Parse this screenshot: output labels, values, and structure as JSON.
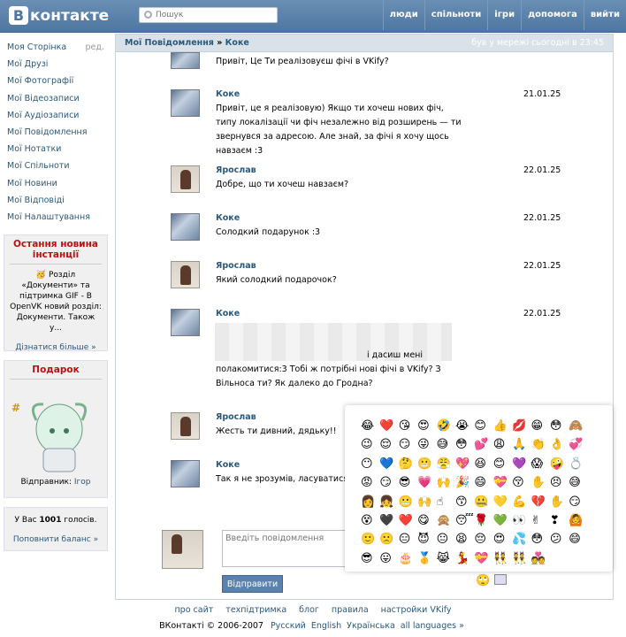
{
  "brand": {
    "logo": "В",
    "logo_text": "контакте"
  },
  "search": {
    "placeholder": "Пошук"
  },
  "topnav": [
    "люди",
    "спільноти",
    "ігри",
    "допомога",
    "вийти"
  ],
  "sidebar": {
    "menu": [
      {
        "label": "Моя Сторінка",
        "extra": "ред."
      },
      {
        "label": "Мої Друзі"
      },
      {
        "label": "Мої Фотографії"
      },
      {
        "label": "Мої Відеозаписи"
      },
      {
        "label": "Мої Аудіозаписи"
      },
      {
        "label": "Мої Повідомлення"
      },
      {
        "label": "Мої Нотатки"
      },
      {
        "label": "Мої Спільноти"
      },
      {
        "label": "Мої Новини"
      },
      {
        "label": "Мої Відповіді"
      },
      {
        "label": "Мої Налаштування"
      }
    ],
    "news": {
      "title": "Остання новина інстанції",
      "text": "Розділ «Документи» та підтримка GIF - В OpenVK новий розділ: Документи. Також у...",
      "icon": "🥳",
      "more": "Дізнатися більше »"
    },
    "gift": {
      "title": "Подарок",
      "sender_label": "Відправник:",
      "sender": "Ігор"
    },
    "balance": {
      "prefix": "У Вас",
      "amount": "1001",
      "suffix": "голосів.",
      "link": "Поповнити баланс »"
    }
  },
  "crumbs": {
    "section": "Мої Повідомлення",
    "sep": " » ",
    "user": "Коке",
    "status": "був у мережі сьогодні в 23:45"
  },
  "messages": [
    {
      "avatar": "koke",
      "name": "",
      "text": "Привіт, Це Ти реалізовуєш фічі в VKify?",
      "date": ""
    },
    {
      "avatar": "koke",
      "name": "Коке",
      "text": "Привіт, це я реалізовую) Якщо ти хочеш нових фіч, типу локалізації чи фіч незалежно від розширень — ти звернувся за адресою. Але знай, за фічі я хочу щось навзаєм :3",
      "date": "21.01.25"
    },
    {
      "avatar": "yar",
      "name": "Ярослав",
      "text": "Добре, що ти хочеш навзаєм?",
      "date": "22.01.25"
    },
    {
      "avatar": "koke",
      "name": "Коке",
      "text": "Солодкий подарунок :3",
      "date": "22.01.25"
    },
    {
      "avatar": "yar",
      "name": "Ярослав",
      "text": "Який солодкий подарочок?",
      "date": "22.01.25"
    },
    {
      "avatar": "koke",
      "name": "Коке",
      "text": "і дасиш мені полакомитися:3 Тобі ж потрібні нові фічі в VKify? З Вільноса ти? Як далеко до Гродна?",
      "date": "22.01.25"
    },
    {
      "avatar": "yar",
      "name": "Ярослав",
      "text": "Жесть ти дивний, дядьку!!",
      "date": ""
    },
    {
      "avatar": "koke",
      "name": "Коке",
      "text": "Так я не зрозумів, ласуватися я не хочеш ? :(",
      "date": ""
    }
  ],
  "composer": {
    "placeholder": "Введіть повідомлення",
    "send": "Відправити"
  },
  "emoji": [
    "😂",
    "❤️",
    "😘",
    "😍",
    "🤣",
    "😭",
    "😊",
    "👍",
    "💋",
    "😁",
    "😳",
    "🙈",
    "😉",
    "😌",
    "😏",
    "😜",
    "😅",
    "😳",
    "💕",
    "😩",
    "🙏",
    "👏",
    "👌",
    "💞",
    "😶",
    "💙",
    "🤔",
    "😬",
    "😤",
    "💖",
    "😆",
    "😊",
    "💜",
    "😱",
    "🤪",
    "💍",
    "😡",
    "😏",
    "😎",
    "💗",
    "🙌",
    "🎉",
    "😄",
    "💝",
    "😚",
    "✋",
    "😣",
    "😅",
    "👩",
    "👧",
    "😬",
    "🙌",
    "☝",
    "😙",
    "🤐",
    "💛",
    "💪",
    "💔",
    "✋",
    "😏",
    "😵",
    "🖤",
    "❤️",
    "😋",
    "🙊",
    "😴",
    "🌹",
    "💚",
    "👀",
    "✌",
    "❣",
    "🙆",
    "🙂",
    "🙁",
    "😑",
    "😈",
    "😐",
    "😫",
    "😔",
    "😍",
    "💦",
    "😳",
    "😕",
    "😄",
    "😎",
    "😛",
    "🎂",
    "🥇",
    "😹",
    "💃",
    "💝",
    "👯",
    "👯",
    "💑"
  ],
  "footer": {
    "links": [
      "про сайт",
      "техпідтримка",
      "блог",
      "правила",
      "настройки VKify"
    ],
    "copyright": "ВКонтакті © 2006-2007",
    "langs": [
      "Русский",
      "English",
      "Українська",
      "all languages »"
    ]
  }
}
